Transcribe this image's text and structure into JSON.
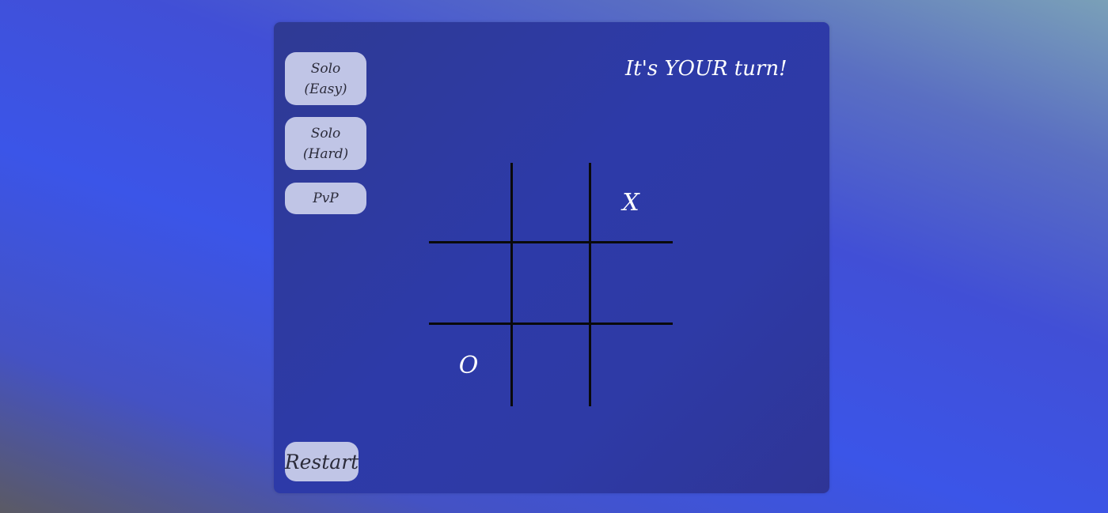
{
  "modes": {
    "easy": {
      "line1": "Solo",
      "line2": "(Easy)"
    },
    "hard": {
      "line1": "Solo",
      "line2": "(Hard)"
    },
    "pvp": "PvP"
  },
  "status": "It's YOUR turn!",
  "restart_label": "Restart",
  "board": {
    "cells": [
      "",
      "",
      "X",
      "",
      "",
      "",
      "O",
      "",
      ""
    ]
  }
}
